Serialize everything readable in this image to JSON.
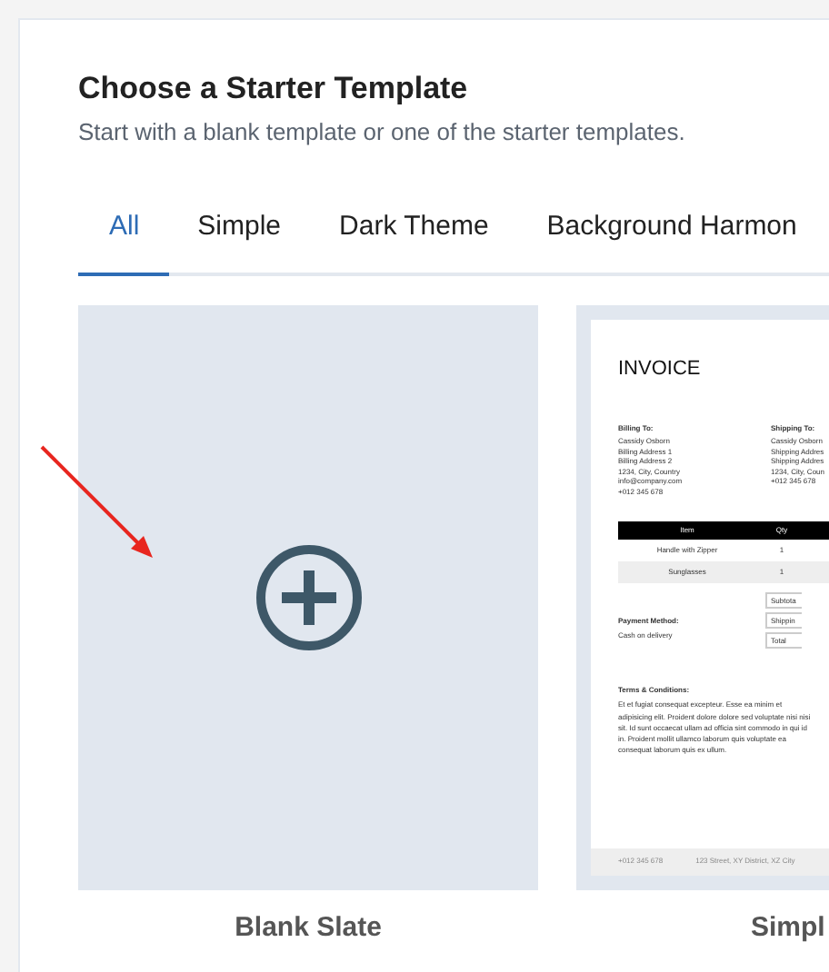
{
  "heading": {
    "title": "Choose a Starter Template",
    "subtitle": "Start with a blank template or one of the starter templates."
  },
  "tabs": [
    {
      "label": "All",
      "selected": true
    },
    {
      "label": "Simple",
      "selected": false
    },
    {
      "label": "Dark Theme",
      "selected": false
    },
    {
      "label": "Background Harmon",
      "selected": false
    }
  ],
  "templates": [
    {
      "kind": "blank",
      "name": "Blank Slate"
    },
    {
      "kind": "invoice",
      "name": "Simpl",
      "invoice": {
        "title": "INVOICE",
        "billing": {
          "heading": "Billing To:",
          "lines": [
            "Cassidy Osborn",
            "Billing Address 1",
            "Billing Address 2",
            "1234, City, Country",
            "info@company.com",
            "+012 345 678"
          ]
        },
        "shipping": {
          "heading": "Shipping To:",
          "lines": [
            "Cassidy Osborn",
            "Shipping Addres",
            "Shipping Addres",
            "1234, City, Coun",
            "+012 345 678"
          ]
        },
        "table": {
          "columns": [
            "Item",
            "Qty"
          ],
          "rows": [
            [
              "Handle with Zipper",
              "1"
            ],
            [
              "Sunglasses",
              "1"
            ]
          ]
        },
        "totals": [
          "Subtota",
          "Shippin",
          "Total"
        ],
        "payment": {
          "heading": "Payment Method:",
          "value": "Cash on delivery"
        },
        "terms": {
          "heading": "Terms & Conditions:",
          "text": "Et et fugiat consequat excepteur. Esse ea minim et adipisicing elit. Proident dolore dolore sed voluptate nisi nisi sit. Id sunt occaecat ullam ad officia sint commodo in qui id in. Proident mollit ullamco laborum quis voluptate ea consequat laborum quis ex ullum."
        },
        "footer": [
          "+012 345 678",
          "123 Street, XY District, XZ City"
        ]
      }
    }
  ]
}
